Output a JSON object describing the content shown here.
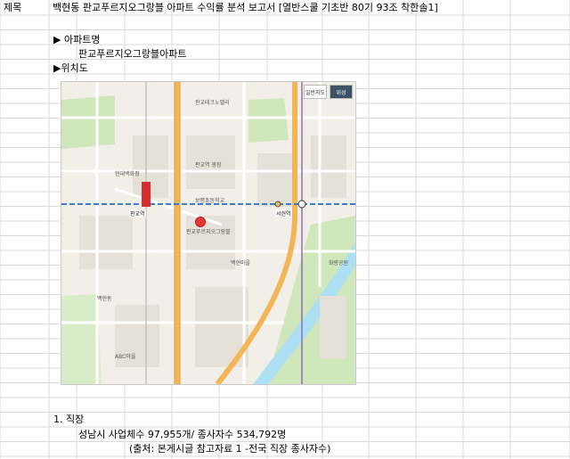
{
  "sheet": {
    "label_col": "제목",
    "title": "백현동 판교푸르지오그랑블 아파트 수익률 분석 보고서 [열반스쿨 기초반 80기 93조 착한솔1]",
    "section_apt_heading": "▶ 아파트명",
    "apt_name": "판교푸르지오그랑블아파트",
    "section_location_heading": "▶위치도",
    "section_job_heading": "1. 직장",
    "job_detail": "성남시 사업체수 97,955개/ 종사자수 534,792명",
    "job_source": "(출처: 본게시글 참고자료 1 -전국 직장 종사자수)"
  },
  "map": {
    "controls": [
      "일반지도",
      "위성"
    ],
    "labels": {
      "area_baekhyeon": "백현마을",
      "area_baekhyeon2": "백현동",
      "station_pangyo": "판교역",
      "station_seohyeon": "서현역",
      "apt_pin": "판교푸르지오그랑블",
      "bldg_hyundai": "현대백화점",
      "bldg_mall": "판교역 광장",
      "bldg_school": "보평초등학교",
      "bldg_abc": "ABC마을",
      "bldg_park": "화랑공원",
      "bldg_center": "판교테크노밸리"
    },
    "colors": {
      "road_main": "#f2b657",
      "road_minor": "#ffffff",
      "park": "#c8e6b0",
      "water": "#aee0f4",
      "subway": "#3a7bd5",
      "pin": "#e53935"
    }
  }
}
